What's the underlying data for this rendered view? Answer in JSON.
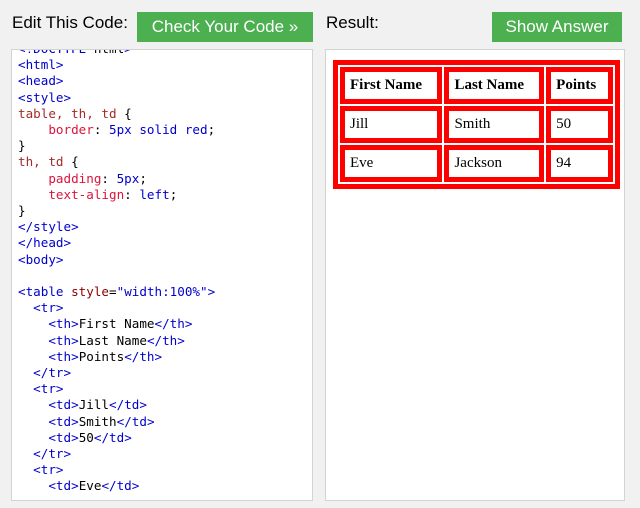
{
  "header": {
    "edit_label": "Edit This Code:",
    "check_button": "Check Your Code »",
    "result_label": "Result:",
    "show_answer_button": "Show Answer"
  },
  "colors": {
    "button_green": "#4CAF50",
    "table_border": "red"
  },
  "editor": {
    "lines": [
      "<!DOCTYPE html>",
      "<html>",
      "<head>",
      "<style>",
      "table, th, td {",
      "    border: 5px solid red;",
      "}",
      "th, td {",
      "    padding: 5px;",
      "    text-align: left;",
      "}",
      "</style>",
      "</head>",
      "<body>",
      "",
      "<table style=\"width:100%\">",
      "  <tr>",
      "    <th>First Name</th>",
      "    <th>Last Name</th>",
      "    <th>Points</th>",
      "  </tr>",
      "  <tr>",
      "    <td>Jill</td>",
      "    <td>Smith</td>",
      "    <td>50</td>",
      "  </tr>",
      "  <tr>",
      "    <td>Eve</td>"
    ]
  },
  "result": {
    "headers": [
      "First Name",
      "Last Name",
      "Points"
    ],
    "rows": [
      [
        "Jill",
        "Smith",
        "50"
      ],
      [
        "Eve",
        "Jackson",
        "94"
      ]
    ]
  }
}
